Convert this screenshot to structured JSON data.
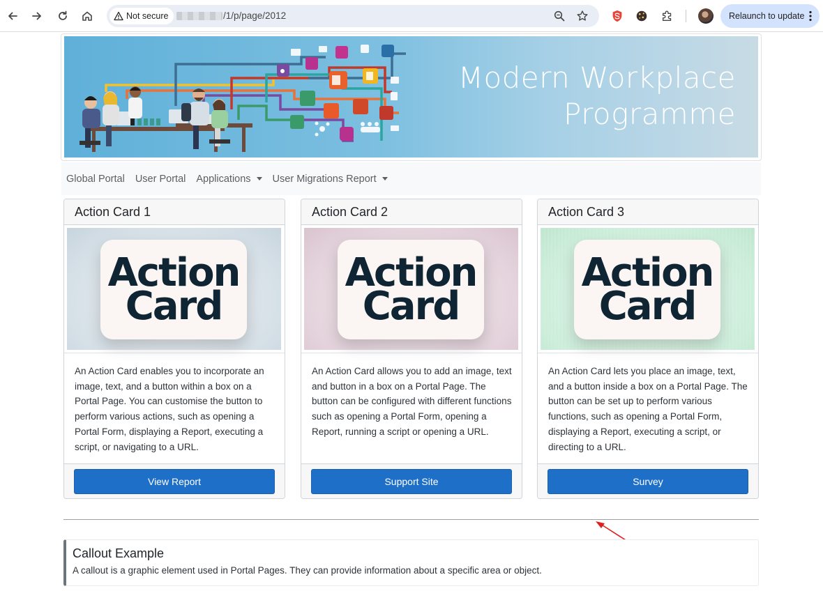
{
  "browser": {
    "security_label": "Not secure",
    "url_path": "/1/p/page/2012",
    "relaunch_label": "Relaunch to update",
    "icons": [
      "back-icon",
      "forward-icon",
      "reload-icon",
      "home-icon",
      "zoom-icon",
      "bookmark-star-icon",
      "extension-icon",
      "puzzle-icon"
    ]
  },
  "banner": {
    "title_line1": "Modern Workplace",
    "title_line2": "Programme"
  },
  "nav": {
    "items": [
      {
        "label": "Global Portal"
      },
      {
        "label": "User Portal"
      },
      {
        "label": "Applications"
      },
      {
        "label": "User Migrations Report"
      }
    ]
  },
  "image_text": {
    "line1": "Action",
    "line2": "Card"
  },
  "cards": [
    {
      "title": "Action Card 1",
      "body": "An Action Card enables you to incorporate an image, text, and a button within a box on a Portal Page. You can customise the button to perform various actions, such as opening a Portal Form, displaying a Report, executing a script, or navigating to a URL.",
      "button": "View Report",
      "image_bg": "#dbe4ea"
    },
    {
      "title": "Action Card 2",
      "body": "An Action Card allows you to add an image, text and button in a box on a Portal Page. The button can be configured with different functions such as opening a Portal Form, opening a Report, running a script or opening a URL.",
      "button": "Support Site",
      "image_bg": "#e6d6de"
    },
    {
      "title": "Action Card 3",
      "body": "An Action Card lets you place an image, text, and a button inside a box on a Portal Page. The button can be set up to perform various functions, such as opening a Portal Form, displaying a Report, executing a script, or directing to a URL.",
      "button": "Survey",
      "image_bg": "#d3eedf"
    }
  ],
  "callout": {
    "title": "Callout Example",
    "text": "A callout is a graphic element used in Portal Pages. They can provide information about a specific area or object."
  },
  "colors": {
    "button": "#1e6fc7",
    "annotation_arrow": "#e02020"
  }
}
